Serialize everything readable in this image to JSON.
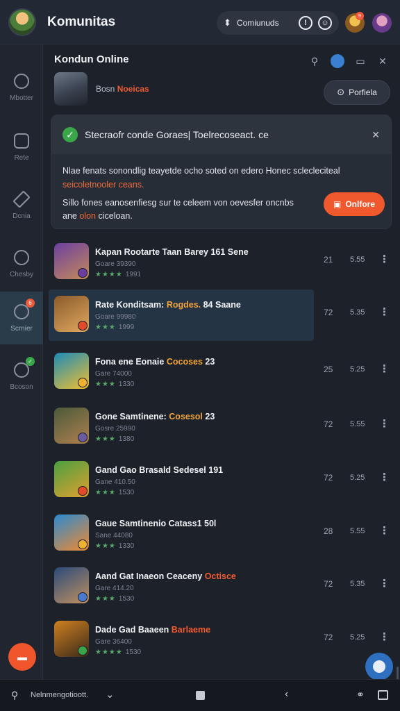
{
  "app": {
    "title": "Komunitas"
  },
  "top": {
    "pill_label": "Comiunuds"
  },
  "sidebar": {
    "items": [
      {
        "label": "Mbotter",
        "icon": "gear-icon"
      },
      {
        "label": "Rete",
        "icon": "chat-icon"
      },
      {
        "label": "Dcnia",
        "icon": "brush-icon"
      },
      {
        "label": "Chesby",
        "icon": "message-icon"
      },
      {
        "label": "Scrnier",
        "icon": "community-icon",
        "badge": "6",
        "badge_color": "#f0583a"
      },
      {
        "label": "Bcoson",
        "icon": "user-icon",
        "badge": "✓",
        "badge_color": "#3aa64a"
      }
    ]
  },
  "header": {
    "title": "Kondun Online",
    "hero_prefix": "Bosn",
    "hero_highlight": "Noeicas",
    "follow_label": "Porfiela"
  },
  "notice": {
    "title": "Stecraofr conde Goraes| Toelrecoseact. ce",
    "p1_text": "Nlae fenats sonondlig teayetde ocho soted on edero Honec sclecleciteal",
    "p1_orange": "seicoletnooler ceans.",
    "p2_text": "Sillo fones eanosenfiesg sur te celeem von oevesfer oncnbs",
    "p2_prefix": "ane",
    "p2_orange": "olon",
    "p2_suffix": "ciceloan.",
    "button_label": "Onlfore"
  },
  "list": [
    {
      "title": "Kapan Rootarte Taan Barey 161 Sene",
      "hl": "",
      "hl2": "",
      "sub": "Goare 39390",
      "rating": "★★★★",
      "count": "1991",
      "n1": "21",
      "n2": "5.55",
      "thumb": [
        "#6b3fa0",
        "#c58a5a"
      ],
      "badge_color": "#6b3fa0"
    },
    {
      "title": "Rate Konditsam:",
      "hl": "Rogdes.",
      "tail": "84 Saane",
      "hl2": "",
      "sub": "Goare 99980",
      "rating": "★★★",
      "count": "1999",
      "n1": "72",
      "n2": "5.35",
      "thumb": [
        "#8a5a2a",
        "#e0a860"
      ],
      "badge_color": "#e24a2a"
    },
    {
      "title": "Fona ene Eonaie",
      "hl": "Cocoses",
      "tail": "23",
      "hl2": "",
      "sub": "Gare 74000",
      "rating": "★★★",
      "count": "1330",
      "n1": "25",
      "n2": "5.25",
      "thumb": [
        "#1a8ab8",
        "#f0c030"
      ],
      "badge_color": "#f0b030"
    },
    {
      "title": "Gone Samtinene:",
      "hl": "Cosesol",
      "tail": "23",
      "hl2": "",
      "sub": "Gosre 25990",
      "rating": "★★★",
      "count": "1380",
      "n1": "72",
      "n2": "5.55",
      "thumb": [
        "#4a5a3a",
        "#b08050"
      ],
      "badge_color": "#6a5aa0"
    },
    {
      "title": "Gand Gao Brasald Sedesel 191",
      "hl": "",
      "tail": "",
      "hl2": "",
      "sub": "Gane 410.50",
      "rating": "★★★",
      "count": "1530",
      "n1": "72",
      "n2": "5.25",
      "thumb": [
        "#4aa040",
        "#e0a030"
      ],
      "badge_color": "#e24a2a"
    },
    {
      "title": "Gaue Samtinenio Catass1 50l",
      "hl": "",
      "tail": "",
      "hl2": "",
      "sub": "Sane 44080",
      "rating": "★★★",
      "count": "1330",
      "n1": "28",
      "n2": "5.55",
      "thumb": [
        "#2a8ad0",
        "#f08a30"
      ],
      "badge_color": "#f0b030"
    },
    {
      "title": "Aand Gat Inaeon Ceaceny",
      "hl": "",
      "tail": "",
      "hl2": "Octisce",
      "sub": "Gare 414.20",
      "rating": "★★★",
      "count": "1530",
      "n1": "72",
      "n2": "5.35",
      "thumb": [
        "#2a4a7a",
        "#c09060"
      ],
      "badge_color": "#4a7ad0"
    },
    {
      "title": "Dade Gad Baaeen",
      "hl": "",
      "tail": "",
      "hl2": "Barlaeme",
      "sub": "Gare 36400",
      "rating": "★★★★",
      "count": "1530",
      "n1": "72",
      "n2": "5.25",
      "thumb": [
        "#d08020",
        "#3a2a1a"
      ],
      "badge_color": "#3aa64a"
    }
  ],
  "bottom": {
    "search_label": "Nelnmengotioott."
  },
  "colors": {
    "accent": "#f0582e",
    "success": "#3aa64a",
    "highlight": "#f0a33a",
    "background": "#1c212a"
  }
}
